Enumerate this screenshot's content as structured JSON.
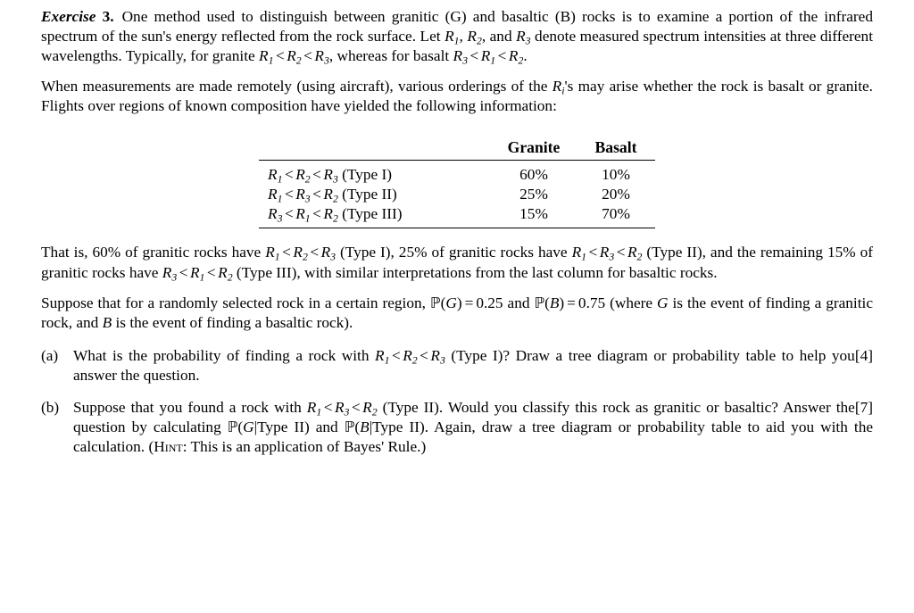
{
  "document": {
    "exercise_label": "Exercise",
    "exercise_number": "3.",
    "intro_paragraph_1_a": "One method used to distinguish between granitic (G) and basaltic (B) rocks is to examine a portion of the infrared spectrum of the sun's energy reflected from the rock surface. Let ",
    "intro_paragraph_1_b": ", and ",
    "intro_paragraph_1_c": " denote measured spectrum intensities at three different wavelengths. Typically, for granite ",
    "intro_paragraph_1_d": ", whereas for basalt ",
    "intro_paragraph_1_e": ".",
    "paragraph_2_a": "When measurements are made remotely (using aircraft), various orderings of the ",
    "paragraph_2_b": "'s may arise whether the rock is basalt or granite. Flights over regions of known composition have yielded the following information:",
    "paragraph_3_a": "That is, 60% of granitic rocks have ",
    "paragraph_3_b": " (Type I), 25% of granitic rocks have ",
    "paragraph_3_c": " (Type II), and the remaining 15% of granitic rocks have ",
    "paragraph_3_d": " (Type III), with similar interpretations from the last column for basaltic rocks.",
    "paragraph_4_a": "Suppose that for a randomly selected rock in a certain region, ",
    "paragraph_4_b": " and ",
    "paragraph_4_c": " (where ",
    "paragraph_4_d": " is the event of finding a granitic rock, and ",
    "paragraph_4_e": " is the event of finding a basaltic rock)."
  },
  "math": {
    "R": "R",
    "sub1": "1",
    "sub2": "2",
    "sub3": "3",
    "subi": "i",
    "less_than": "<",
    "G": "G",
    "B": "B",
    "P_blackboard": "ℙ",
    "equals": "=",
    "p_granite": "0.25",
    "p_basalt": "0.75"
  },
  "table": {
    "headers": [
      "",
      "Granite",
      "Basalt"
    ],
    "rows": [
      {
        "condition_parts": [
          "R",
          "1",
          "<",
          "R",
          "2",
          "<",
          "R",
          "3"
        ],
        "type_label": "(Type I)",
        "granite": "60%",
        "basalt": "10%"
      },
      {
        "condition_parts": [
          "R",
          "1",
          "<",
          "R",
          "3",
          "<",
          "R",
          "2"
        ],
        "type_label": "(Type II)",
        "granite": "25%",
        "basalt": "20%"
      },
      {
        "condition_parts": [
          "R",
          "3",
          "<",
          "R",
          "1",
          "<",
          "R",
          "2"
        ],
        "type_label": "(Type III)",
        "granite": "15%",
        "basalt": "70%"
      }
    ]
  },
  "questions": [
    {
      "marker": "(a)",
      "text_a": "What is the probability of finding a rock with ",
      "text_b": " (Type I)? Draw a tree diagram or probability table to help you answer the question.",
      "marks": "[4]"
    },
    {
      "marker": "(b)",
      "text_a": "Suppose that you found a rock with ",
      "text_b": " (Type II). Would you classify this rock as granitic or basaltic? Answer the question by calculating ",
      "text_c": "(",
      "text_d": "|Type II) and ",
      "text_e": "(",
      "text_f": "|Type II). Again, draw a tree diagram or probability table to aid you with the calculation. (",
      "hint_label": "Hint",
      "text_g": ": This is an application of Bayes' Rule.)",
      "marks": "[7]"
    }
  ]
}
